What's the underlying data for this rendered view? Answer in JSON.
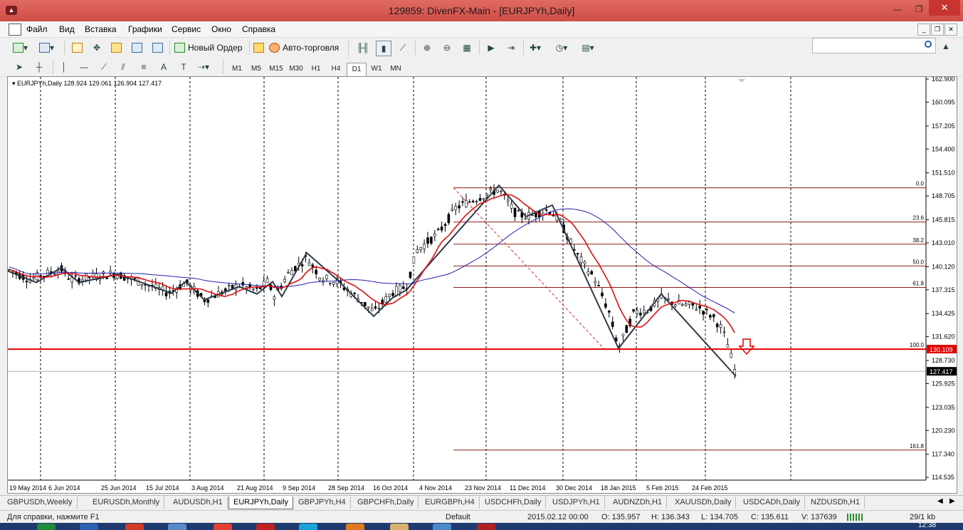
{
  "window": {
    "title": "129859: DivenFX-Main - [EURJPYh,Daily]"
  },
  "menu": [
    "Файл",
    "Вид",
    "Вставка",
    "Графики",
    "Сервис",
    "Окно",
    "Справка"
  ],
  "toolbar": {
    "new_order": "Новый Ордер",
    "autotrading": "Авто-торговля"
  },
  "timeframes": [
    "M1",
    "M5",
    "M15",
    "M30",
    "H1",
    "H4",
    "D1",
    "W1",
    "MN"
  ],
  "active_timeframe": "D1",
  "chart_header": "EURJPYh,Daily  128.924 129.061 126.904 127.417",
  "price_axis": [
    "162.900",
    "160.095",
    "157.205",
    "154.400",
    "151.510",
    "148.705",
    "145.815",
    "143.010",
    "140.120",
    "137.315",
    "134.425",
    "131.620",
    "128.730",
    "125.925",
    "123.035",
    "120.230",
    "117.340",
    "114.535"
  ],
  "date_axis": [
    "19 May 2014",
    "6 Jun 2014",
    "25 Jun 2014",
    "15 Jul 2014",
    "3 Aug 2014",
    "21 Aug 2014",
    "9 Sep 2014",
    "28 Sep 2014",
    "16 Oct 2014",
    "4 Nov 2014",
    "23 Nov 2014",
    "11 Dec 2014",
    "30 Dec 2014",
    "18 Jan 2015",
    "5 Feb 2015",
    "24 Feb 2015"
  ],
  "fib_levels": [
    "0.0",
    "23.6",
    "38.2",
    "50.0",
    "61.8",
    "100.0",
    "161.8"
  ],
  "price_tags": {
    "level": "130.109",
    "current": "127.417"
  },
  "tabs": [
    "GBPUSDh,Weekly",
    "EURUSDh,Monthly",
    "AUDUSDh,H1",
    "EURJPYh,Daily",
    "GBPJPYh,H4",
    "GBPCHFh,Daily",
    "EURGBPh,H4",
    "USDCHFh,Daily",
    "USDJPYh,H1",
    "AUDNZDh,H1",
    "XAUUSDh,Daily",
    "USDCADh,Daily",
    "NZDUSDh,H1"
  ],
  "active_tab": "EURJPYh,Daily",
  "status": {
    "help": "Для справки, нажмите F1",
    "profile": "Default",
    "time": "2015.02.12 00:00",
    "open": "O: 135.957",
    "high": "H: 136.343",
    "low": "L: 134.705",
    "close": "C: 135.611",
    "volume": "V: 137639",
    "traffic": "29/1 kb"
  },
  "clock": "12:38",
  "colors": {
    "titlebar": "#d9534f",
    "fib": "#8b1a1a",
    "ma_fast": "#e01010",
    "ma_slow": "#2020b0",
    "level_line": "#e00000"
  }
}
